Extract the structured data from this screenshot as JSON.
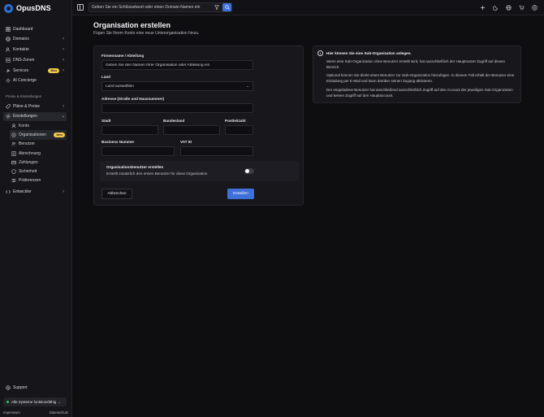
{
  "brand": {
    "name": "OpusDNS",
    "accent": "#3f70d9",
    "badge_color": "#f2c94c"
  },
  "topbar": {
    "search_placeholder": "Geben Sie ein Schlüsselwort oder einen Domain-Namen ein",
    "icons": [
      "sidebar-toggle-icon",
      "filter-icon",
      "search-icon",
      "plus-icon",
      "moon-icon",
      "globe-icon",
      "cart-icon",
      "user-icon"
    ]
  },
  "sidebar": {
    "items": [
      {
        "label": "Dashboard",
        "icon": "dashboard-icon"
      },
      {
        "label": "Domains",
        "icon": "globe-icon",
        "chevron": true
      },
      {
        "label": "Kontakte",
        "icon": "contacts-icon",
        "chevron": true
      },
      {
        "label": "DNS-Zonen",
        "icon": "dns-icon",
        "chevron": true
      },
      {
        "label": "Services",
        "icon": "services-icon",
        "badge": "Neu",
        "chevron": true
      },
      {
        "label": "AI Concierge",
        "icon": "ai-icon"
      }
    ],
    "section_label": "Preise & Einstellungen",
    "pricing": {
      "label": "Pläne & Preise",
      "icon": "plans-icon"
    },
    "settings": {
      "label": "Einstellungen",
      "icon": "gear-icon",
      "children": [
        {
          "label": "Konto",
          "icon": "user-icon"
        },
        {
          "label": "Organisationen",
          "icon": "org-icon",
          "badge": "Neu",
          "active": true
        },
        {
          "label": "Benutzer",
          "icon": "users-icon"
        },
        {
          "label": "Abrechnung",
          "icon": "billing-icon"
        },
        {
          "label": "Zahlungen",
          "icon": "card-icon"
        },
        {
          "label": "Sicherheit",
          "icon": "shield-icon"
        },
        {
          "label": "Präferenzen",
          "icon": "sliders-icon"
        }
      ]
    },
    "developer": {
      "label": "Entwickler",
      "icon": "code-icon"
    },
    "support": {
      "label": "Support",
      "icon": "support-icon"
    },
    "status": "Alle Systeme funktionsfähig",
    "footer": {
      "imprint": "Impressum",
      "privacy": "Datenschutz"
    }
  },
  "page": {
    "title": "Organisation erstellen",
    "subtitle": "Fügen Sie Ihrem Konto eine neue Unterorganisation hinzu."
  },
  "form": {
    "company_label": "Firmenname / Abteilung",
    "company_placeholder": "Geben Sie den Namen Ihrer Organisation oder Abteilung ein",
    "country_label": "Land",
    "country_value": "Land auswählen",
    "address_label": "Adresse (Straße und Hausnummer)",
    "city_label": "Stadt",
    "state_label": "Bundesland",
    "zip_label": "Postleitzahl",
    "business_label": "Business Nummer",
    "vat_label": "VAT ID",
    "toggle_title": "Organisationsbenutzer erstellen",
    "toggle_desc": "Erstellt zusätzlich den ersten Benutzer für diese Organisation.",
    "toggle_on": false,
    "cancel": "Abbrechen",
    "submit": "Erstellen"
  },
  "info": {
    "title": "Hier können Sie eine Sub-Organization anlegen.",
    "p1": "Wenn eine Sub-Organization ohne Benutzer erstellt wird, hat ausschließlich der Hauptnutzer Zugriff auf diesen Bereich.",
    "p2": "Optional können Sie direkt einen Benutzer zur Sub-Organization hinzufügen. In diesem Fall erhält der Benutzer eine Einladung per E-Mail und kann darüber seinen Zugang aktivieren.",
    "p3": "Der eingeladene Benutzer hat anschließend ausschließlich Zugriff auf den Account der jeweiligen Sub-Organization und keinen Zugriff auf den Hauptaccount."
  }
}
